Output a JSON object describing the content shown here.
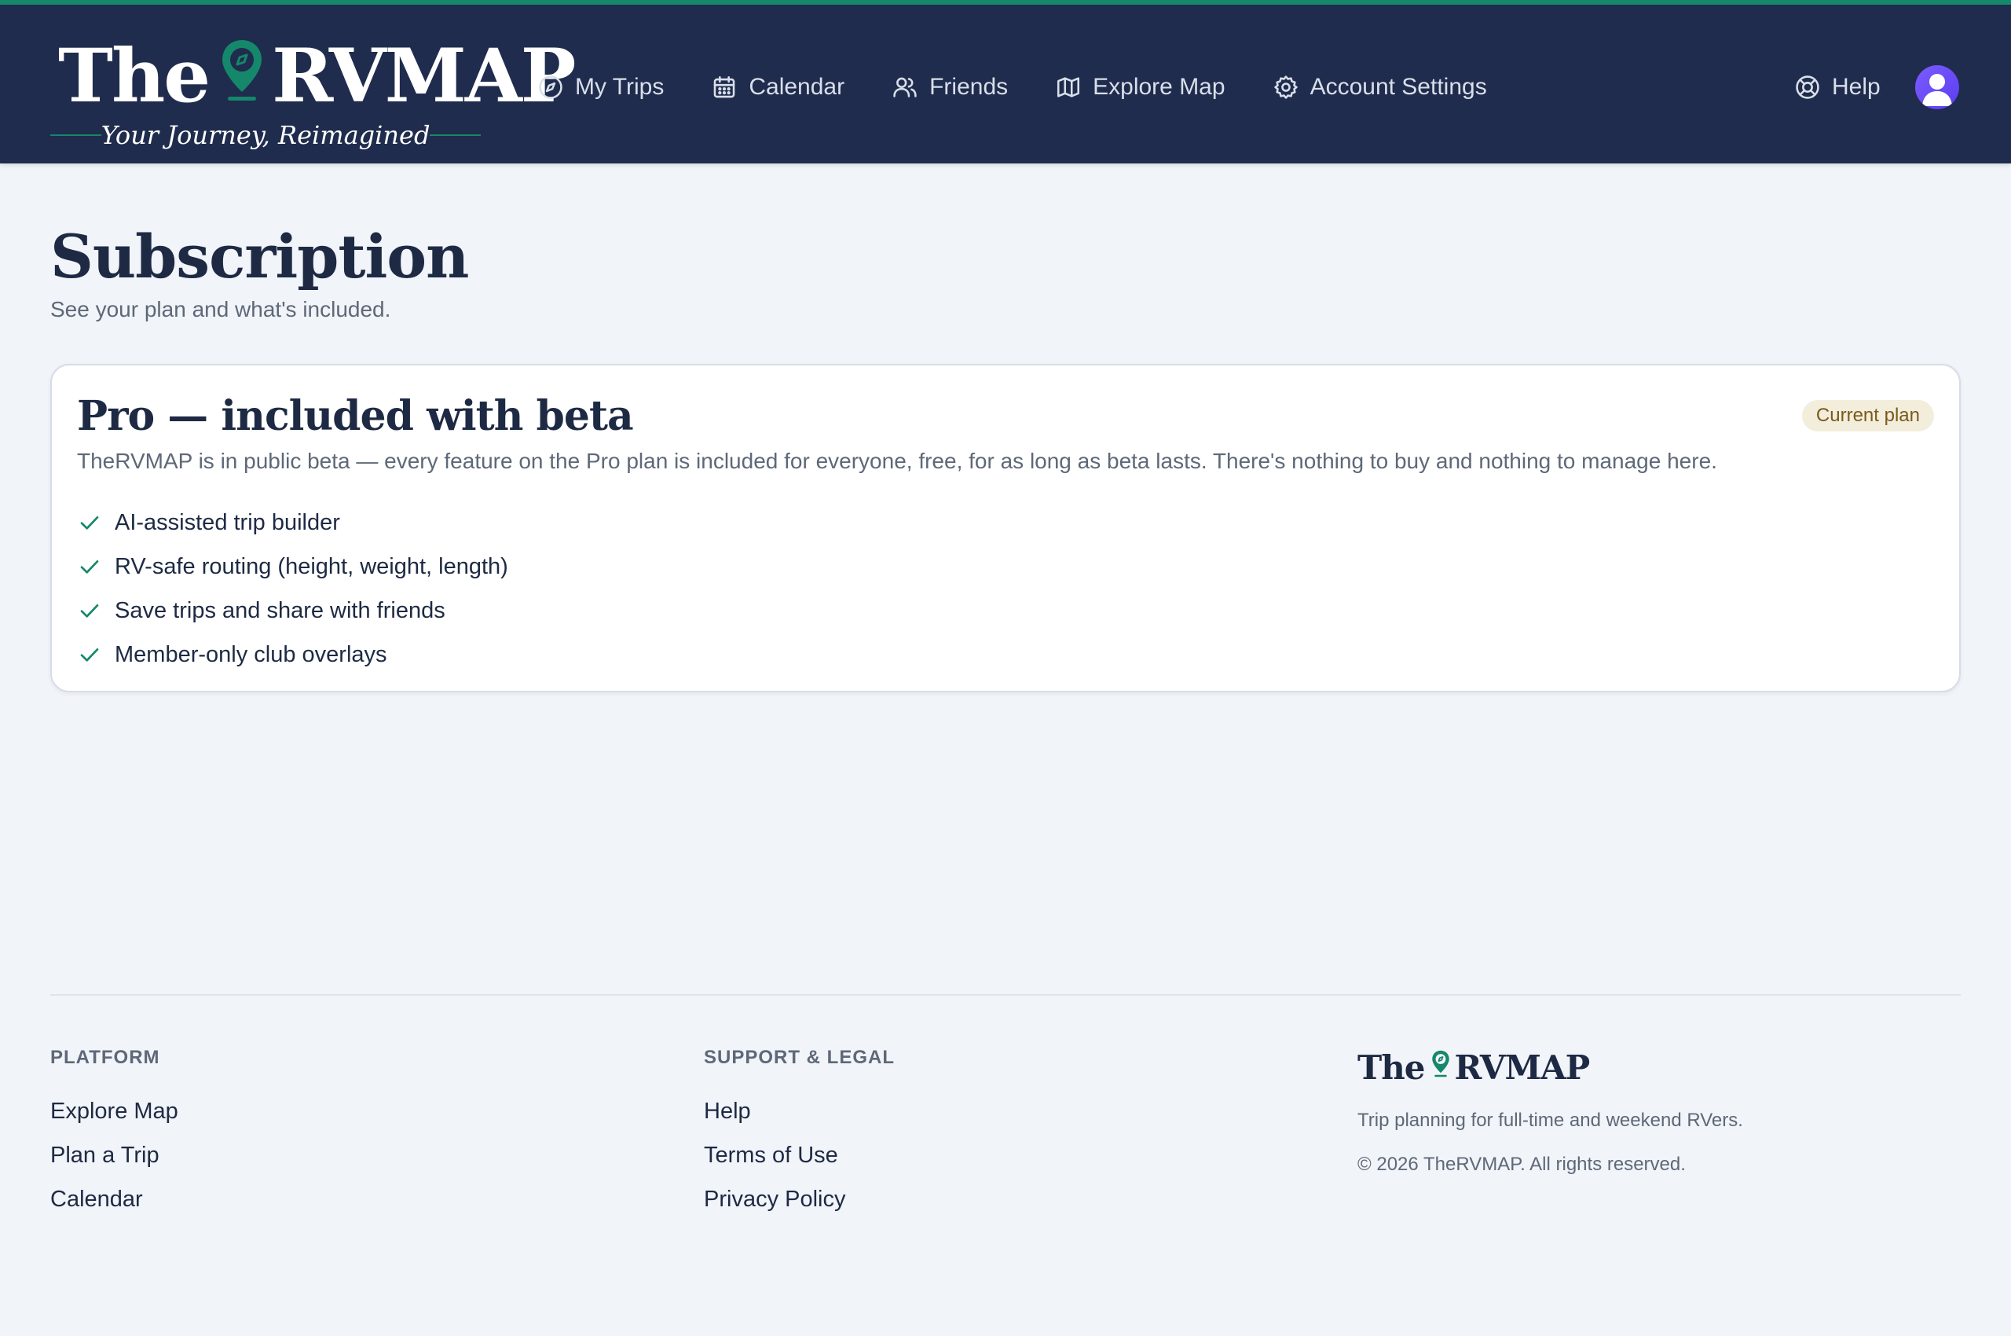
{
  "brand": {
    "logo_left": "The",
    "logo_right": "RVMAP",
    "tagline": "Your Journey, Reimagined",
    "accent_color": "#15876a",
    "header_color": "#1f2c4d"
  },
  "nav": {
    "items": [
      {
        "label": "My Trips",
        "icon": "compass-icon"
      },
      {
        "label": "Calendar",
        "icon": "calendar-icon"
      },
      {
        "label": "Friends",
        "icon": "friends-icon"
      },
      {
        "label": "Explore Map",
        "icon": "map-icon"
      },
      {
        "label": "Account Settings",
        "icon": "gear-icon"
      }
    ],
    "help_label": "Help",
    "help_icon": "lifebuoy-icon",
    "avatar_icon": "user-avatar-icon"
  },
  "page": {
    "title": "Subscription",
    "subtitle": "See your plan and what's included."
  },
  "plan": {
    "title": "Pro — included with beta",
    "badge": "Current plan",
    "description": "TheRVMAP is in public beta — every feature on the Pro plan is included for everyone, free, for as long as beta lasts. There's nothing to buy and nothing to manage here.",
    "features": [
      "AI-assisted trip builder",
      "RV-safe routing (height, weight, length)",
      "Save trips and share with friends",
      "Member-only club overlays"
    ]
  },
  "footer": {
    "platform": {
      "title": "PLATFORM",
      "links": [
        "Explore Map",
        "Plan a Trip",
        "Calendar"
      ]
    },
    "support": {
      "title": "SUPPORT & LEGAL",
      "links": [
        "Help",
        "Terms of Use",
        "Privacy Policy"
      ]
    },
    "brand_left": "The",
    "brand_right": "RVMAP",
    "tagline": "Trip planning for full-time and weekend RVers.",
    "copyright": "© 2026 TheRVMAP. All rights reserved."
  }
}
